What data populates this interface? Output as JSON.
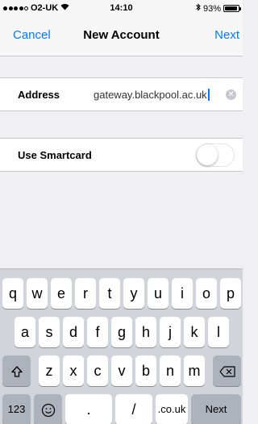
{
  "status_bar": {
    "carrier": "O2-UK",
    "time": "14:10",
    "battery_text": "93%",
    "battery_level": 0.93,
    "signal_bars": 4
  },
  "nav": {
    "cancel_label": "Cancel",
    "title": "New Account",
    "next_label": "Next"
  },
  "form": {
    "address_label": "Address",
    "address_value": "gateway.blackpool.ac.uk",
    "smartcard_label": "Use Smartcard",
    "smartcard_enabled": false
  },
  "keyboard": {
    "row1": [
      "q",
      "w",
      "e",
      "r",
      "t",
      "y",
      "u",
      "i",
      "o",
      "p"
    ],
    "row2": [
      "a",
      "s",
      "d",
      "f",
      "g",
      "h",
      "j",
      "k",
      "l"
    ],
    "row3": [
      "z",
      "x",
      "c",
      "v",
      "b",
      "n",
      "m"
    ],
    "numbers_label": "123",
    "period_label": ".",
    "slash_label": "/",
    "domain_label": ".co.uk",
    "next_label": "Next"
  },
  "colors": {
    "accent": "#007aff",
    "background": "#efeff4",
    "keyboard_bg": "#d1d5db",
    "key_dark": "#acb3bc"
  }
}
